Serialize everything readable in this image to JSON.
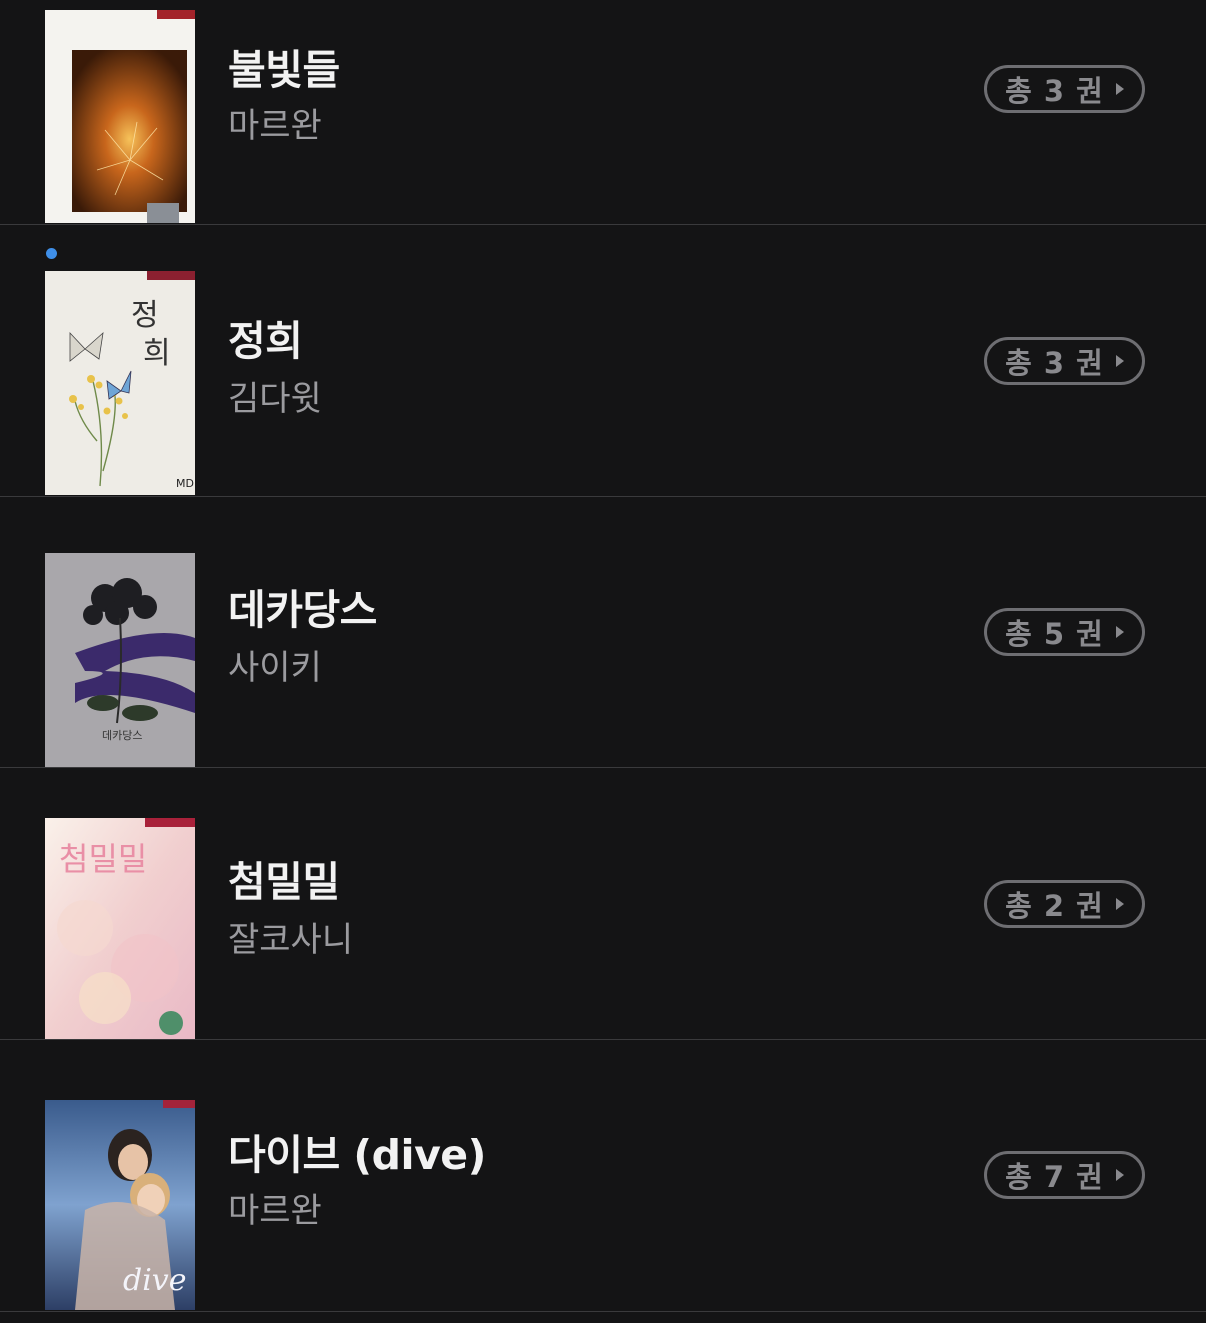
{
  "books": [
    {
      "title": "불빛들",
      "author": "마르완",
      "volume_label": "총 3 권",
      "unread": false,
      "cover_icon": "sparkler-cover"
    },
    {
      "title": "정희",
      "author": "김다윗",
      "volume_label": "총 3 권",
      "unread": true,
      "cover_icon": "butterfly-flower-cover"
    },
    {
      "title": "데카당스",
      "author": "사이키",
      "volume_label": "총 5 권",
      "unread": false,
      "cover_icon": "black-rose-ribbon-cover"
    },
    {
      "title": "첨밀밀",
      "author": "잘코사니",
      "volume_label": "총 2 권",
      "unread": false,
      "cover_icon": "pink-watercolor-cover"
    },
    {
      "title": "다이브 (dive)",
      "author": "마르완",
      "volume_label": "총 7 권",
      "unread": false,
      "cover_icon": "couple-illustration-cover"
    }
  ],
  "colors": {
    "background": "#141415",
    "divider": "#3a3a3c",
    "unread_dot": "#3f8fe8",
    "badge_border": "#6e6e72"
  }
}
